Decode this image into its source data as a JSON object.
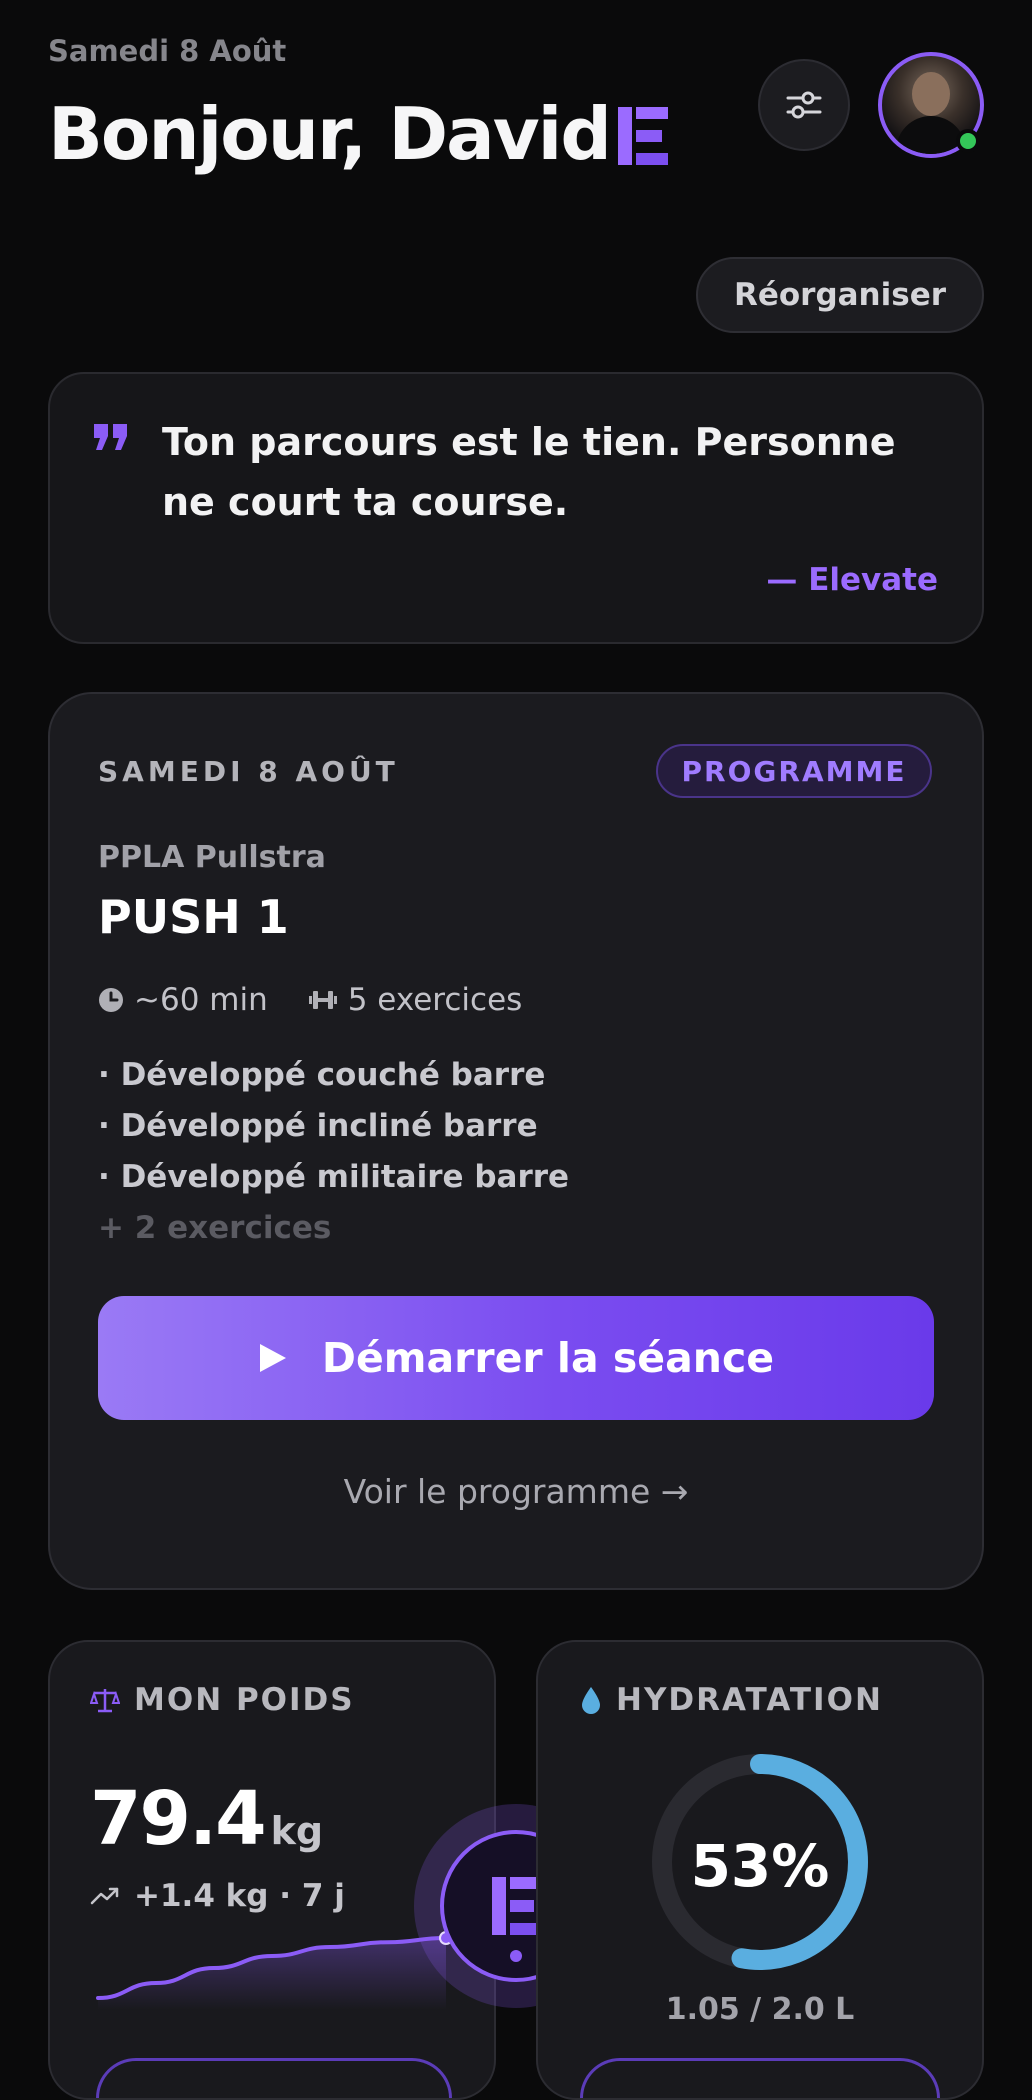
{
  "header": {
    "date": "Samedi 8 Août",
    "greeting": "Bonjour, David",
    "filter_icon": "sliders-icon",
    "avatar_icon": "user-avatar",
    "online": true
  },
  "reorganize_label": "Réorganiser",
  "quote": {
    "text": "Ton parcours est le tien. Personne ne court ta course.",
    "author": "— Elevate"
  },
  "program_card": {
    "date": "SAMEDI 8 AOÛT",
    "badge": "PROGRAMME",
    "program_name": "PPLA Pullstra",
    "session_name": "PUSH 1",
    "duration": "~60 min",
    "exercise_count": "5 exercices",
    "exercises": [
      "· Développé couché barre",
      "· Développé incliné barre",
      "· Développé militaire barre"
    ],
    "more": "+ 2 exercices",
    "start_label": "Démarrer la séance",
    "see_program": "Voir le programme →"
  },
  "weight": {
    "title": "MON POIDS",
    "value": "79.4",
    "unit": "kg",
    "delta": "+1.4 kg · 7 j",
    "trend": [
      0.0,
      0.25,
      0.5,
      0.7,
      0.85,
      0.93,
      1.0
    ]
  },
  "hydration": {
    "title": "HYDRATATION",
    "percent_label": "53%",
    "progress": 0.53,
    "amount": "1.05 / 2.0 L"
  },
  "colors": {
    "accent": "#8b5cf6",
    "water": "#5aaee0",
    "online": "#34c759"
  }
}
